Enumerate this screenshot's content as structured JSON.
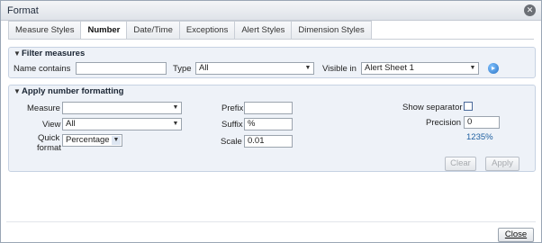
{
  "dialog": {
    "title": "Format",
    "close_icon": "close-icon"
  },
  "tabs": [
    {
      "label": "Measure Styles",
      "active": false
    },
    {
      "label": "Number",
      "active": true
    },
    {
      "label": "Date/Time",
      "active": false
    },
    {
      "label": "Exceptions",
      "active": false
    },
    {
      "label": "Alert Styles",
      "active": false
    },
    {
      "label": "Dimension Styles",
      "active": false
    }
  ],
  "filter": {
    "heading": "Filter measures",
    "name_contains_label": "Name contains",
    "name_contains_value": "",
    "type_label": "Type",
    "type_value": "All",
    "visible_in_label": "Visible in",
    "visible_in_value": "Alert Sheet 1"
  },
  "formatting": {
    "heading": "Apply number formatting",
    "measure_label": "Measure",
    "measure_value": "",
    "view_label": "View",
    "view_value": "All",
    "quick_format_label_1": "Quick",
    "quick_format_label_2": "format",
    "quick_format_value": "Percentage",
    "prefix_label": "Prefix",
    "prefix_value": "",
    "suffix_label": "Suffix",
    "suffix_value": "%",
    "scale_label": "Scale",
    "scale_value": "0.01",
    "show_separator_label": "Show separator",
    "show_separator_checked": false,
    "precision_label": "Precision",
    "precision_value": "0",
    "preview_value": "1235%",
    "clear_label": "Clear",
    "apply_label": "Apply"
  },
  "footer": {
    "close_label": "Close"
  },
  "colors": {
    "accent": "#1e5fa0",
    "panel_bg": "#eef2f8",
    "panel_border": "#c6d2e2"
  }
}
